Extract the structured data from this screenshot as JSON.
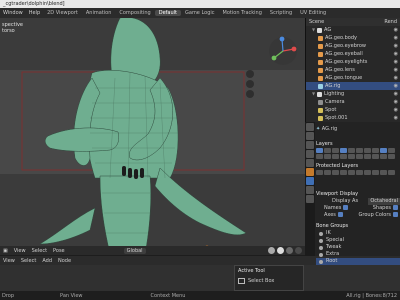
{
  "title": "_cgtrader\\dolphin\\blend]",
  "menu": [
    "Window",
    "Help"
  ],
  "workspace_tabs": [
    "2D Viewport",
    "Animation",
    "Compositing",
    "Default",
    "Game Logic",
    "Motion Tracking",
    "Scripting",
    "UV Editing"
  ],
  "active_tab": "Default",
  "viewport": {
    "label_line1": "spective",
    "label_line2": "torso",
    "bottom": [
      "View",
      "Select",
      "Pose"
    ],
    "orientation": "Global"
  },
  "node_editor": {
    "header": [
      "View",
      "Select",
      "Add",
      "Node"
    ]
  },
  "active_tool": {
    "title": "Active Tool",
    "item": "Select Box"
  },
  "status": {
    "left": "Drop",
    "middle": "Pan View",
    "right": "Context Menu",
    "stats": "All.rig | Bones:8/712"
  },
  "outliner": {
    "header": "Scene",
    "header_right": "Rend",
    "rows": [
      {
        "label": "AG",
        "indent": 1
      },
      {
        "label": "AG.geo.body",
        "indent": 2
      },
      {
        "label": "AG.geo.eyebrow",
        "indent": 2
      },
      {
        "label": "AG.geo.eyeball",
        "indent": 2
      },
      {
        "label": "AG.geo.eyelights",
        "indent": 2
      },
      {
        "label": "AG.geo.lens",
        "indent": 2
      },
      {
        "label": "AG.geo.tongue",
        "indent": 2
      },
      {
        "label": "AG.rig",
        "indent": 2,
        "selected": true
      },
      {
        "label": "Lighting",
        "indent": 1
      },
      {
        "label": "Camera",
        "indent": 2
      },
      {
        "label": "Spot",
        "indent": 2
      },
      {
        "label": "Spot.001",
        "indent": 2
      }
    ]
  },
  "properties": {
    "breadcrumb": "AG.rig",
    "layers_label": "Layers",
    "protected_label": "Protected Layers",
    "viewport_display": "Viewport Display",
    "display_as_label": "Display As",
    "display_as_value": "Octahedral",
    "names_label": "Names",
    "shapes_label": "Shapes",
    "axes_label": "Axes",
    "group_colors_label": "Group Colors",
    "bone_groups_label": "Bone Groups",
    "bone_groups": [
      {
        "label": "IK",
        "selected": false
      },
      {
        "label": "Special",
        "selected": false
      },
      {
        "label": "Tweak",
        "selected": false
      },
      {
        "label": "Extra",
        "selected": false
      },
      {
        "label": "Root",
        "selected": true
      }
    ]
  }
}
